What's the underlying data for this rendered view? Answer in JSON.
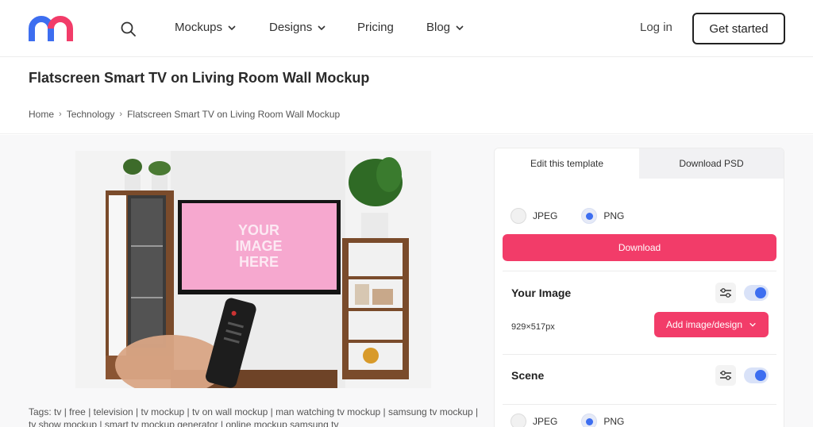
{
  "header": {
    "logo_icon": "m-logo",
    "logo_colors": [
      "#3d6ef0",
      "#f23c69"
    ],
    "search_icon": "search-icon",
    "nav": [
      {
        "label": "Mockups",
        "has_dropdown": true
      },
      {
        "label": "Designs",
        "has_dropdown": true
      },
      {
        "label": "Pricing",
        "has_dropdown": false
      },
      {
        "label": "Blog",
        "has_dropdown": true
      }
    ],
    "login_label": "Log in",
    "cta_label": "Get started"
  },
  "page": {
    "title": "Flatscreen Smart TV on Living Room Wall Mockup",
    "breadcrumb": [
      "Home",
      "Technology",
      "Flatscreen Smart TV on Living Room Wall Mockup"
    ]
  },
  "preview": {
    "screen_text": [
      "YOUR",
      "IMAGE",
      "HERE"
    ],
    "screen_color": "#f6a8cf"
  },
  "tags": {
    "label": "Tags:",
    "items": [
      "tv",
      "free",
      "television",
      "tv mockup",
      "tv on wall mockup",
      "man watching tv mockup",
      "samsung tv mockup",
      "tv show mockup",
      "smart tv mockup generator",
      "online mockup samsung tv"
    ]
  },
  "panel": {
    "tabs": [
      {
        "label": "Edit this template",
        "active": true
      },
      {
        "label": "Download PSD",
        "active": false
      }
    ],
    "format_options": [
      {
        "label": "JPEG",
        "selected": false
      },
      {
        "label": "PNG",
        "selected": true
      }
    ],
    "download_label": "Download",
    "your_image": {
      "title": "Your Image",
      "dimensions": "929×517px",
      "add_label": "Add image/design",
      "toggle_on": true
    },
    "scene": {
      "title": "Scene",
      "toggle_on": true
    },
    "scene_format_options": [
      {
        "label": "JPEG",
        "selected": false
      },
      {
        "label": "PNG",
        "selected": true
      }
    ],
    "accent_color": "#f23c69",
    "toggle_color": "#3d6ef0"
  }
}
